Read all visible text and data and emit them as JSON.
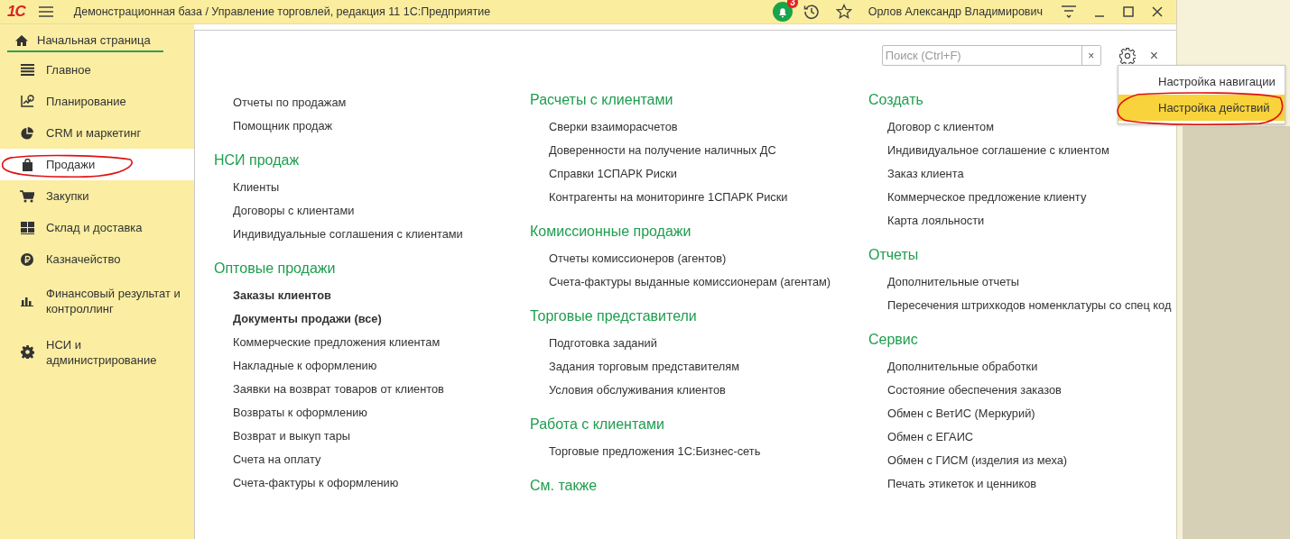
{
  "window": {
    "logo": "1С",
    "title": "Демонстрационная база / Управление торговлей, редакция 11 1С:Предприятие",
    "notifications_badge": "3",
    "user": "Орлов Александр Владимирович"
  },
  "home_tab": {
    "label": "Начальная страница",
    "selected": true
  },
  "sidebar": {
    "items": [
      {
        "label": "Главное",
        "selected": false,
        "circled": false
      },
      {
        "label": "Планирование",
        "selected": false,
        "circled": false
      },
      {
        "label": "CRM и маркетинг",
        "selected": false,
        "circled": false
      },
      {
        "label": "Продажи",
        "selected": true,
        "circled": true
      },
      {
        "label": "Закупки",
        "selected": false,
        "circled": false
      },
      {
        "label": "Склад и доставка",
        "selected": false,
        "circled": false
      },
      {
        "label": "Казначейство",
        "selected": false,
        "circled": false
      },
      {
        "label": "Финансовый результат и контроллинг",
        "selected": false,
        "circled": false
      },
      {
        "label": "НСИ и администрирование",
        "selected": false,
        "circled": false
      }
    ]
  },
  "search": {
    "placeholder": "Поиск (Ctrl+F)",
    "clear": "×"
  },
  "close_button": "×",
  "settings_menu": {
    "items": [
      {
        "label": "Настройка навигации",
        "selected": false,
        "circled": false
      },
      {
        "label": "Настройка действий",
        "selected": true,
        "circled": true
      }
    ]
  },
  "columns": [
    {
      "groups": [
        {
          "items": [
            {
              "label": "Отчеты по продажам",
              "bold": false
            },
            {
              "label": "Помощник продаж",
              "bold": false
            }
          ]
        },
        {
          "title": "НСИ продаж",
          "items": [
            {
              "label": "Клиенты",
              "bold": false
            },
            {
              "label": "Договоры с клиентами",
              "bold": false
            },
            {
              "label": "Индивидуальные соглашения с клиентами",
              "bold": false
            }
          ]
        },
        {
          "title": "Оптовые продажи",
          "items": [
            {
              "label": "Заказы клиентов",
              "bold": true
            },
            {
              "label": "Документы продажи (все)",
              "bold": true
            },
            {
              "label": "Коммерческие предложения клиентам",
              "bold": false
            },
            {
              "label": "Накладные к оформлению",
              "bold": false
            },
            {
              "label": "Заявки на возврат товаров от клиентов",
              "bold": false
            },
            {
              "label": "Возвраты к оформлению",
              "bold": false
            },
            {
              "label": "Возврат и выкуп тары",
              "bold": false
            },
            {
              "label": "Счета на оплату",
              "bold": false
            },
            {
              "label": "Счета-фактуры к оформлению",
              "bold": false
            }
          ]
        }
      ]
    },
    {
      "groups": [
        {
          "title": "Расчеты с клиентами",
          "items": [
            {
              "label": "Сверки взаиморасчетов",
              "bold": false
            },
            {
              "label": "Доверенности на получение наличных ДС",
              "bold": false
            },
            {
              "label": "Справки 1СПАРК Риски",
              "bold": false
            },
            {
              "label": "Контрагенты на мониторинге 1СПАРК Риски",
              "bold": false
            }
          ]
        },
        {
          "title": "Комиссионные продажи",
          "items": [
            {
              "label": "Отчеты комиссионеров (агентов)",
              "bold": false
            },
            {
              "label": "Счета-фактуры выданные комиссионерам (агентам)",
              "bold": false
            }
          ]
        },
        {
          "title": "Торговые представители",
          "items": [
            {
              "label": "Подготовка заданий",
              "bold": false
            },
            {
              "label": "Задания торговым представителям",
              "bold": false
            },
            {
              "label": "Условия обслуживания клиентов",
              "bold": false
            }
          ]
        },
        {
          "title": "Работа с клиентами",
          "items": [
            {
              "label": "Торговые предложения 1С:Бизнес-сеть",
              "bold": false
            }
          ]
        },
        {
          "title": "См. также"
        }
      ]
    },
    {
      "groups": [
        {
          "title": "Создать",
          "items": [
            {
              "label": "Договор с клиентом",
              "bold": false
            },
            {
              "label": "Индивидуальное соглашение с клиентом",
              "bold": false
            },
            {
              "label": "Заказ клиента",
              "bold": false
            },
            {
              "label": "Коммерческое предложение клиенту",
              "bold": false
            },
            {
              "label": "Карта лояльности",
              "bold": false
            }
          ]
        },
        {
          "title": "Отчеты",
          "items": [
            {
              "label": "Дополнительные отчеты",
              "bold": false
            },
            {
              "label": "Пересечения штрихкодов номенклатуры со спец код",
              "bold": false
            }
          ]
        },
        {
          "title": "Сервис",
          "items": [
            {
              "label": "Дополнительные обработки",
              "bold": false
            },
            {
              "label": "Состояние обеспечения заказов",
              "bold": false
            },
            {
              "label": "Обмен с ВетИС (Меркурий)",
              "bold": false
            },
            {
              "label": "Обмен с ЕГАИС",
              "bold": false
            },
            {
              "label": "Обмен с ГИСМ (изделия из меха)",
              "bold": false
            },
            {
              "label": "Печать этикеток и ценников",
              "bold": false
            }
          ]
        }
      ]
    }
  ]
}
